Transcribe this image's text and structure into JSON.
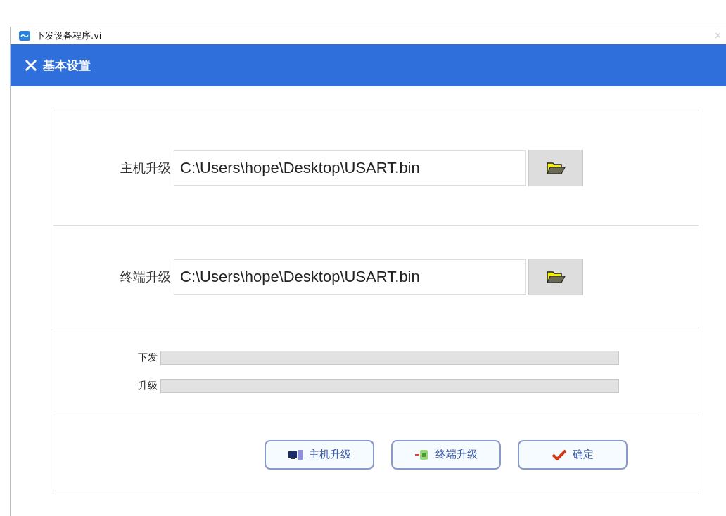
{
  "window": {
    "title": "下发设备程序.vi",
    "close": "×"
  },
  "header": {
    "title": "基本设置"
  },
  "files": [
    {
      "label": "主机升级",
      "value": "C:\\Users\\hope\\Desktop\\USART.bin"
    },
    {
      "label": "终端升级",
      "value": "C:\\Users\\hope\\Desktop\\USART.bin"
    }
  ],
  "progress": [
    {
      "label": "下发"
    },
    {
      "label": "升级"
    }
  ],
  "buttons": [
    {
      "label": "主机升级",
      "kind": "host"
    },
    {
      "label": "终端升级",
      "kind": "terminal"
    },
    {
      "label": "确定",
      "kind": "ok"
    }
  ]
}
